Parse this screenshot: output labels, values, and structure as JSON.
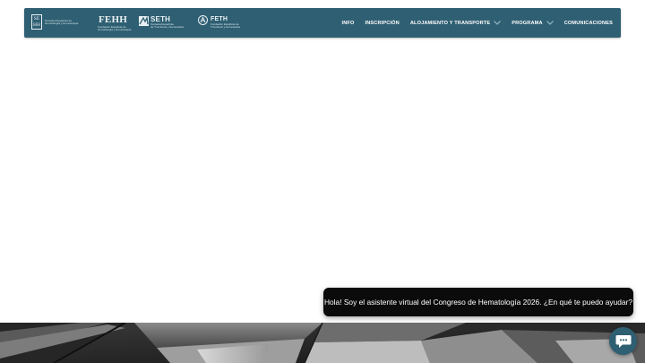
{
  "header": {
    "logos": [
      {
        "name": "SEHH",
        "mark_letters": [
          "SE",
          "HH"
        ],
        "caption_lines": [
          "Sociedad Española de",
          "Hematología y Hemoterapia"
        ]
      },
      {
        "name": "FEHH",
        "caption_lines": [
          "Fundación Española de",
          "Hematología y Hemoterapia"
        ]
      },
      {
        "name": "SETH",
        "caption_lines": [
          "Sociedad Española",
          "de Trombosis y Hemostasia"
        ]
      },
      {
        "name": "FETH",
        "caption_lines": [
          "Fundación Española de",
          "Trombosis y Hemostasia"
        ]
      }
    ],
    "nav": [
      {
        "label": "INFO",
        "has_dropdown": false
      },
      {
        "label": "INSCRIPCIÓN",
        "has_dropdown": false
      },
      {
        "label": "ALOJAMIENTO Y TRANSPORTE",
        "has_dropdown": true
      },
      {
        "label": "PROGRAMA",
        "has_dropdown": true
      },
      {
        "label": "COMUNICACIONES",
        "has_dropdown": false
      }
    ]
  },
  "chat": {
    "greeting": "Hola! Soy el asistente virtual del Congreso de Hematología 2026. ¿En qué te puedo ayudar?",
    "launcher_icon": "chat-icon"
  },
  "colors": {
    "header_bg": "#2f5f72",
    "nav_text": "#ffffff",
    "chevron": "#9fc3cf",
    "chat_bubble_bg": "#0b0b0b",
    "launcher_bg": "#2f5f72"
  }
}
